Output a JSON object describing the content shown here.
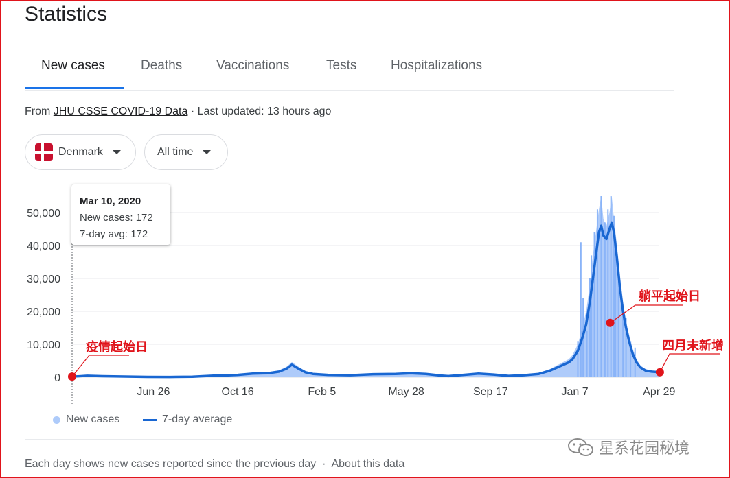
{
  "page": {
    "title": "Statistics"
  },
  "tabs": [
    "New cases",
    "Deaths",
    "Vaccinations",
    "Tests",
    "Hospitalizations"
  ],
  "source": {
    "prefix": "From",
    "link": "JHU CSSE COVID-19 Data",
    "suffix": "· Last updated: 13 hours ago"
  },
  "filters": {
    "country": "Denmark",
    "range": "All time"
  },
  "tooltip": {
    "date": "Mar 10, 2020",
    "new_cases": "New cases: 172",
    "avg": "7-day avg: 172"
  },
  "legend": {
    "new_cases": "New cases",
    "avg": "7-day average"
  },
  "footer": {
    "note": "Each day shows new cases reported since the previous day",
    "dot": "·",
    "link": "About this data"
  },
  "annotations": [
    {
      "label": "疫情起始日",
      "x": 0,
      "y": 172
    },
    {
      "label": "躺平起始日",
      "x": 715,
      "y": 16500
    },
    {
      "label": "四月末新增",
      "x": 781,
      "y": 1500
    }
  ],
  "watermark": "星系花园秘境",
  "chart_data": {
    "type": "area",
    "x_unit": "days since Mar 10, 2020",
    "xticks": [
      {
        "x": 108,
        "label": "Jun 26"
      },
      {
        "x": 220,
        "label": "Oct 16"
      },
      {
        "x": 332,
        "label": "Feb 5"
      },
      {
        "x": 444,
        "label": "May 28"
      },
      {
        "x": 556,
        "label": "Sep 17"
      },
      {
        "x": 668,
        "label": "Jan 7"
      },
      {
        "x": 780,
        "label": "Apr 29"
      }
    ],
    "yticks": [
      0,
      10000,
      20000,
      30000,
      40000,
      50000
    ],
    "ytick_labels": [
      "0",
      "10,000",
      "20,000",
      "30,000",
      "40,000",
      "50,000"
    ],
    "xlim": [
      0,
      782
    ],
    "ylim": [
      0,
      55000
    ],
    "series": [
      {
        "name": "7-day average",
        "points": [
          [
            0,
            172
          ],
          [
            10,
            300
          ],
          [
            20,
            450
          ],
          [
            40,
            300
          ],
          [
            70,
            200
          ],
          [
            100,
            100
          ],
          [
            130,
            80
          ],
          [
            160,
            150
          ],
          [
            190,
            500
          ],
          [
            205,
            550
          ],
          [
            220,
            700
          ],
          [
            240,
            1100
          ],
          [
            260,
            1200
          ],
          [
            275,
            1700
          ],
          [
            285,
            2600
          ],
          [
            292,
            3800
          ],
          [
            300,
            2700
          ],
          [
            310,
            1500
          ],
          [
            320,
            1000
          ],
          [
            340,
            700
          ],
          [
            370,
            600
          ],
          [
            400,
            900
          ],
          [
            430,
            1000
          ],
          [
            450,
            1200
          ],
          [
            470,
            1000
          ],
          [
            490,
            500
          ],
          [
            500,
            350
          ],
          [
            520,
            700
          ],
          [
            540,
            1100
          ],
          [
            560,
            800
          ],
          [
            580,
            400
          ],
          [
            600,
            600
          ],
          [
            620,
            1000
          ],
          [
            635,
            2000
          ],
          [
            650,
            3500
          ],
          [
            660,
            4500
          ],
          [
            665,
            5500
          ],
          [
            672,
            8000
          ],
          [
            678,
            12000
          ],
          [
            683,
            16000
          ],
          [
            688,
            23000
          ],
          [
            692,
            30000
          ],
          [
            696,
            37000
          ],
          [
            700,
            44000
          ],
          [
            703,
            46000
          ],
          [
            706,
            43000
          ],
          [
            710,
            42000
          ],
          [
            714,
            45000
          ],
          [
            717,
            47000
          ],
          [
            720,
            44000
          ],
          [
            724,
            36000
          ],
          [
            728,
            27000
          ],
          [
            732,
            20000
          ],
          [
            736,
            15000
          ],
          [
            740,
            11000
          ],
          [
            745,
            7000
          ],
          [
            750,
            4500
          ],
          [
            755,
            3000
          ],
          [
            762,
            2000
          ],
          [
            770,
            1700
          ],
          [
            781,
            1500
          ]
        ]
      },
      {
        "name": "New cases",
        "points": [
          [
            0,
            172
          ],
          [
            10,
            500
          ],
          [
            20,
            600
          ],
          [
            40,
            350
          ],
          [
            70,
            250
          ],
          [
            100,
            150
          ],
          [
            130,
            100
          ],
          [
            160,
            200
          ],
          [
            190,
            650
          ],
          [
            205,
            700
          ],
          [
            220,
            900
          ],
          [
            240,
            1400
          ],
          [
            260,
            1500
          ],
          [
            275,
            2100
          ],
          [
            285,
            3200
          ],
          [
            292,
            4600
          ],
          [
            300,
            3300
          ],
          [
            310,
            1900
          ],
          [
            320,
            1300
          ],
          [
            340,
            900
          ],
          [
            370,
            800
          ],
          [
            400,
            1200
          ],
          [
            430,
            1300
          ],
          [
            450,
            1500
          ],
          [
            470,
            1300
          ],
          [
            490,
            700
          ],
          [
            500,
            450
          ],
          [
            520,
            900
          ],
          [
            540,
            1400
          ],
          [
            560,
            1000
          ],
          [
            580,
            500
          ],
          [
            600,
            800
          ],
          [
            620,
            1300
          ],
          [
            635,
            2500
          ],
          [
            650,
            4300
          ],
          [
            660,
            5500
          ],
          [
            665,
            6800
          ],
          [
            672,
            10000
          ],
          [
            678,
            15000
          ],
          [
            683,
            20000
          ],
          [
            688,
            28000
          ],
          [
            692,
            37000
          ],
          [
            696,
            44000
          ],
          [
            700,
            51000
          ],
          [
            703,
            55000
          ],
          [
            706,
            48000
          ],
          [
            710,
            46000
          ],
          [
            714,
            50000
          ],
          [
            717,
            55000
          ],
          [
            720,
            48000
          ],
          [
            724,
            40000
          ],
          [
            728,
            31000
          ],
          [
            732,
            23000
          ],
          [
            736,
            17000
          ],
          [
            740,
            13000
          ],
          [
            745,
            8500
          ],
          [
            750,
            5500
          ],
          [
            755,
            3600
          ],
          [
            762,
            2500
          ],
          [
            770,
            2000
          ],
          [
            781,
            1800
          ]
        ]
      }
    ],
    "spikes": [
      [
        672,
        11000
      ],
      [
        676,
        41000
      ],
      [
        679,
        24000
      ],
      [
        684,
        14000
      ],
      [
        688,
        30000
      ],
      [
        690,
        37000
      ],
      [
        694,
        44000
      ],
      [
        698,
        51000
      ],
      [
        703,
        55000
      ],
      [
        708,
        47000
      ],
      [
        712,
        51000
      ],
      [
        716,
        55000
      ],
      [
        720,
        49000
      ],
      [
        722,
        36000
      ],
      [
        726,
        32000
      ],
      [
        732,
        21000
      ],
      [
        736,
        18000
      ],
      [
        742,
        11000
      ],
      [
        748,
        9000
      ]
    ],
    "colors": {
      "area": "#aecbfa",
      "line": "#1967d2",
      "grid": "#e8eaed",
      "marker": "#e0141b"
    }
  }
}
